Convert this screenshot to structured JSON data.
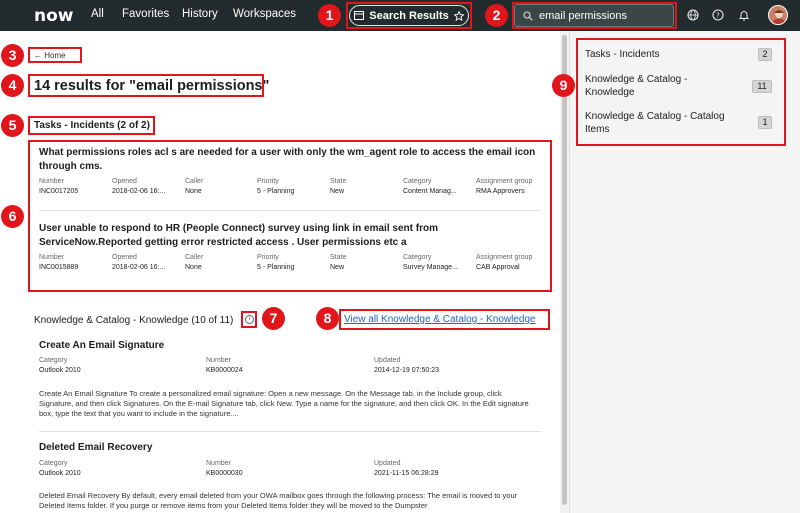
{
  "nav": {
    "logo": "now",
    "links": [
      "All",
      "Favorites",
      "History",
      "Workspaces"
    ],
    "search_results_label": "Search Results",
    "search_value": "email permissions"
  },
  "breadcrumb": "← Home",
  "results_title": "14 results for \"email permissions\"",
  "incidents": {
    "section_title": "Tasks - Incidents (2 of 2)",
    "field_labels": [
      "Number",
      "Opened",
      "Caller",
      "Priority",
      "State",
      "Category",
      "Assignment group"
    ],
    "items": [
      {
        "title": "What permissions roles acl s are needed for a user with only the wm_agent role to access the email icon through cms.",
        "values": [
          "INC0017205",
          "2018-02-06 16:...",
          "None",
          "5 - Planning",
          "New",
          "Content Manag...",
          "RMA Approvers"
        ]
      },
      {
        "title": "User unable to respond to HR (People Connect) survey using link in email sent from ServiceNow.Reported getting error restricted access . User permissions etc a",
        "values": [
          "INC0015889",
          "2018-02-06 16:...",
          "None",
          "5 - Planning",
          "New",
          "Survey Manage...",
          "CAB Approval"
        ]
      }
    ]
  },
  "knowledge": {
    "section_title": "Knowledge & Catalog - Knowledge (10 of 11)",
    "view_all_label": "View all Knowledge & Catalog - Knowledge",
    "field_labels": [
      "Category",
      "Number",
      "Updated"
    ],
    "items": [
      {
        "title": "Create An Email Signature",
        "values": [
          "Outlook 2010",
          "KB0000024",
          "2014-12-19 07:50:23"
        ],
        "body": "Create An Email Signature To create a personalized email signature: Open a new message. On the Message tab, in the Include group, click Signature, and then click Signatures. On the E-mail Signature tab, click New. Type a name for the signature, and then click OK. In the Edit signature box, type the text that you want to include in the signature...."
      },
      {
        "title": "Deleted Email Recovery",
        "values": [
          "Outlook 2010",
          "KB0000030",
          "2021-11-15 06:28:29"
        ],
        "body": "Deleted Email Recovery By default, every email deleted from your OWA mailbox goes through the following process: The email is moved to your Deleted Items folder. If you purge or remove items from your Deleted Items folder they will be moved to the Dumpster"
      }
    ]
  },
  "facets": [
    {
      "label": "Tasks - Incidents",
      "count": "2"
    },
    {
      "label": "Knowledge & Catalog - Knowledge",
      "count": "11"
    },
    {
      "label": "Knowledge & Catalog - Catalog Items",
      "count": "1"
    }
  ],
  "annotations": [
    "1",
    "2",
    "3",
    "4",
    "5",
    "6",
    "7",
    "8",
    "9"
  ],
  "colors": {
    "annotation_red": "#e1161b",
    "nav_bg": "#222c2e",
    "link_blue": "#2563c9",
    "logo_green": "#62d84e"
  }
}
